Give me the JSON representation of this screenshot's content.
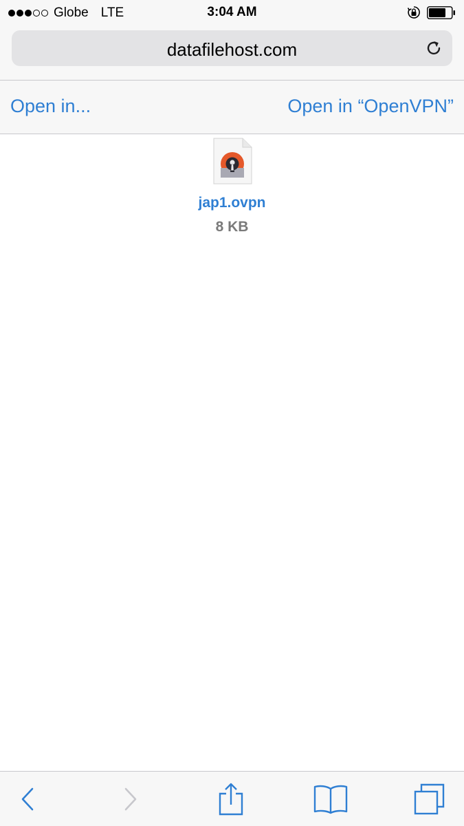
{
  "status_bar": {
    "carrier": "Globe",
    "network": "LTE",
    "time": "3:04 AM",
    "signal_bars_filled": 3,
    "signal_bars_total": 5
  },
  "address_bar": {
    "url": "datafilehost.com",
    "reload_icon": "reload-icon"
  },
  "open_bar": {
    "open_in_label": "Open in...",
    "open_in_app_label": "Open in “OpenVPN”"
  },
  "file": {
    "name": "jap1.ovpn",
    "size": "8 KB",
    "icon": "openvpn-file-icon"
  },
  "toolbar": {
    "icons": [
      "back-chevron-icon",
      "forward-chevron-icon",
      "share-icon",
      "bookmarks-icon",
      "tabs-icon"
    ]
  },
  "colors": {
    "accent": "#2f7fd3",
    "bar_background": "#f7f7f7",
    "address_field": "#e3e3e5",
    "disabled": "#c7c7cc",
    "file_size_text": "#7a7a7a"
  }
}
